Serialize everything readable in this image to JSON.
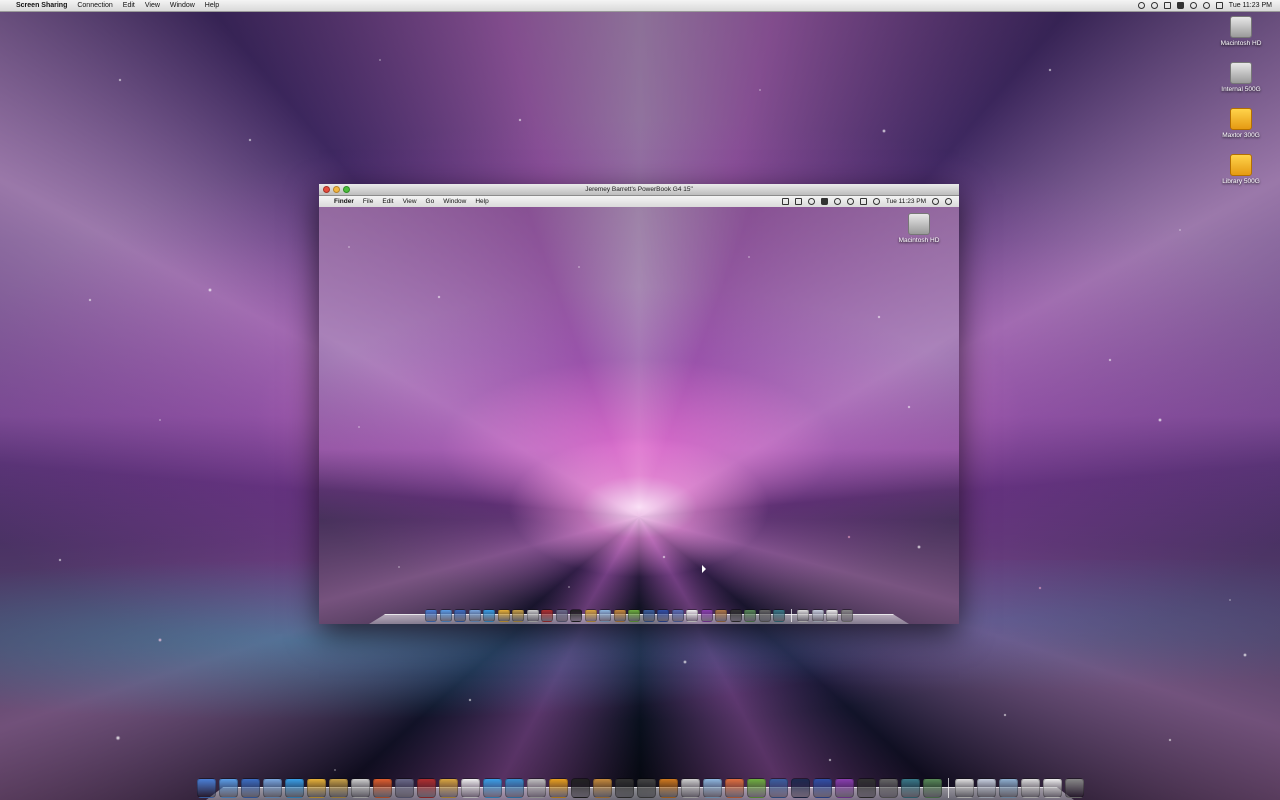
{
  "host_menubar": {
    "app_name": "Screen Sharing",
    "menus": [
      "Connection",
      "Edit",
      "View",
      "Window",
      "Help"
    ],
    "clock": "Tue 11:23 PM"
  },
  "host_desktop_icons": [
    {
      "label": "Macintosh HD",
      "type": "hd"
    },
    {
      "label": "Internal 500G",
      "type": "hd"
    },
    {
      "label": "Maxtor 300G",
      "type": "ext"
    },
    {
      "label": "Library 500G",
      "type": "ext"
    }
  ],
  "remote_window": {
    "title": "Jeremey Barrett's PowerBook G4 15\"",
    "menubar": {
      "app_name": "Finder",
      "menus": [
        "File",
        "Edit",
        "View",
        "Go",
        "Window",
        "Help"
      ],
      "clock": "Tue 11:23 PM"
    },
    "desktop_icon": {
      "label": "Macintosh HD"
    }
  },
  "colors": {
    "remote_dock_icons": [
      "#4a7fd6",
      "#5b9ee8",
      "#3d6fc4",
      "#7aa7e0",
      "#3aa0e8",
      "#e8b23a",
      "#c9a24a",
      "#d0d0d0",
      "#b03030",
      "#6a6a8a",
      "#222222",
      "#d9a640",
      "#8fb8e0",
      "#c68b3e",
      "#6fb040",
      "#3a5fa0",
      "#3050a8",
      "#5a6fb8",
      "#f2f2f2",
      "#8a3fb0",
      "#b07a4a",
      "#333333",
      "#5a8a5a",
      "#666666",
      "#3a7a8a",
      "#e0e0e0",
      "#c8d0e0",
      "#eeeeee",
      "#888888"
    ],
    "host_dock_icons": [
      "#4a7fd6",
      "#5b9ee8",
      "#3d6fc4",
      "#7aa7e0",
      "#3aa0e8",
      "#e8b23a",
      "#c9a24a",
      "#d0d0d0",
      "#e06030",
      "#6a6a8a",
      "#b03030",
      "#d9a640",
      "#f0f0f0",
      "#3aa0e8",
      "#3a8fd0",
      "#c0c0c0",
      "#e8a020",
      "#222222",
      "#c68b3e",
      "#333333",
      "#444444",
      "#d07a20",
      "#d0d0d0",
      "#8fb8e0",
      "#e07040",
      "#6fb040",
      "#3a5fa0",
      "#1d2a50",
      "#3050a8",
      "#8a3fb0",
      "#333333",
      "#666666",
      "#3a7a8a",
      "#5a8a5a"
    ],
    "host_dock_docs": [
      "#e0e0e0",
      "#c8d0e0",
      "#8fb0d0",
      "#dddddd",
      "#eeeeee",
      "#888888"
    ]
  }
}
